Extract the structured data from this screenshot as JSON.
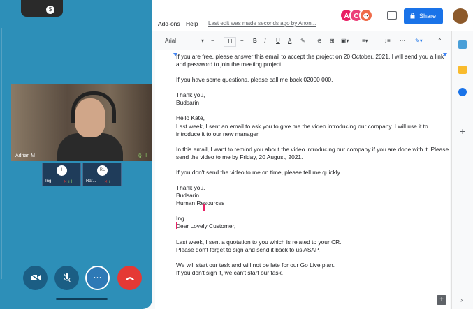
{
  "docs": {
    "menu": [
      "Add-ons",
      "Help"
    ],
    "last_edit": "Last edit was made seconds ago by Anon...",
    "collaborators": [
      {
        "initial": "A",
        "color": "#e91e63"
      },
      {
        "initial": "C",
        "color": "#ec407a"
      },
      {
        "initial": "",
        "color": "#ef6c4a"
      }
    ],
    "share_label": "Share",
    "toolbar": {
      "font": "Arial",
      "font_size": "11",
      "bold": "B",
      "italic": "I",
      "underline": "U",
      "text_color": "A"
    },
    "paragraphs": [
      "If you are free, please answer this email to accept the project on 20 October, 2021. I will send you a link and password to join the meeting project.",
      "If you have some questions, please call me back 02000 000.",
      "Thank you,\nBudsarin",
      "Hello Kate,\nLast week, I sent an email to ask you to give me the video introducing our company. I will use it to introduce it to our new manager.",
      "In this email, I want to remind you about the video introducing our company if you are done with it. Please send the video to me by Friday, 20 August, 2021.",
      "If you don't send the video to me on time, please tell me quickly.",
      "Thank you,\nBudsarin\nHuman Resources\n ",
      "Ing\nDear Lovely Customer,",
      "Last week, I sent a quotation to you which is related to your CR.\nPlease don't forget to sign and send it back to us ASAP.",
      "We will start our task and will not be late for our Go Live plan.\nIf you don't sign it, we can't start our task."
    ]
  },
  "meet": {
    "main_speaker": "Adrian M",
    "tiles": [
      {
        "initial": "I",
        "name": "Ing"
      },
      {
        "initial": "RL",
        "name": "Raf..."
      }
    ],
    "controls": [
      {
        "name": "camera-off-button",
        "color": "#1b5e84"
      },
      {
        "name": "mic-off-button",
        "color": "#1b5e84"
      },
      {
        "name": "more-options-button",
        "color": "#2e79b6"
      },
      {
        "name": "end-call-button",
        "color": "#e53935"
      }
    ]
  }
}
